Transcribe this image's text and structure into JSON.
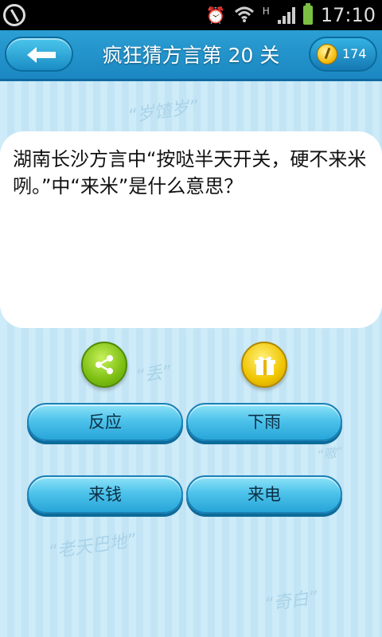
{
  "status_bar": {
    "time": "17:10",
    "network": "H",
    "icons": [
      "debug-icon",
      "alarm-icon",
      "wifi-icon",
      "signal-icon",
      "battery-icon"
    ]
  },
  "header": {
    "title": "疯狂猜方言第 20 关",
    "coins": "174",
    "back_icon": "back-arrow-icon",
    "coin_icon": "coin-icon"
  },
  "background_decorations": [
    "“岁馇岁”",
    "“丢”",
    "“老天巴地”",
    "“奇白”",
    "“嗷”"
  ],
  "question": {
    "text": "湖南长沙方言中“按哒半天开关，硬不来米咧。”中“来米”是什么意思？"
  },
  "actions": {
    "share_icon": "share-icon",
    "gift_icon": "gift-icon"
  },
  "answers": [
    "反应",
    "下雨",
    "来钱",
    "来电"
  ],
  "colors": {
    "title_bar": "#1b87c2",
    "answer_button": "#4ec3eb",
    "share_button": "#7cbf12",
    "gift_button": "#f0c400",
    "background": "#cdebf8"
  }
}
